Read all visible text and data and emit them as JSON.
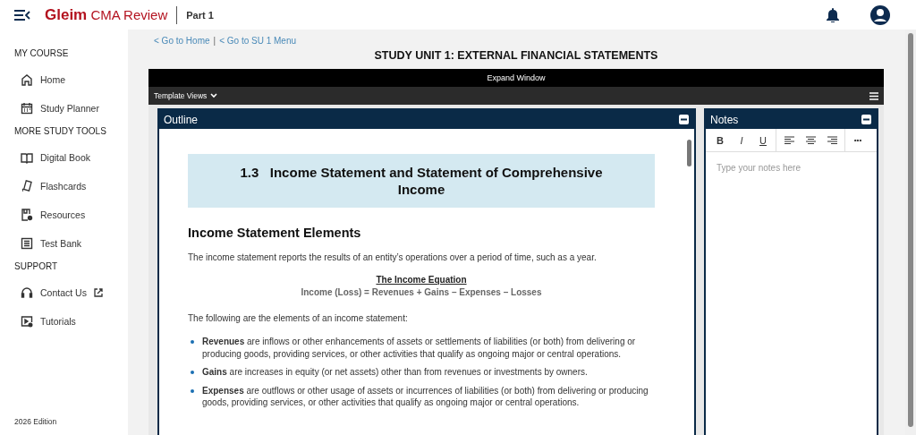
{
  "header": {
    "brand": "Gleim",
    "product": "CMA Review",
    "part": "Part 1"
  },
  "sidebar": {
    "sections": [
      {
        "title": "MY COURSE",
        "items": [
          {
            "label": "Home",
            "external": false
          },
          {
            "label": "Study Planner",
            "external": false
          }
        ]
      },
      {
        "title": "MORE STUDY TOOLS",
        "items": [
          {
            "label": "Digital Book",
            "external": false
          },
          {
            "label": "Flashcards",
            "external": false
          },
          {
            "label": "Resources",
            "external": false
          },
          {
            "label": "Test Bank",
            "external": false
          }
        ]
      },
      {
        "title": "SUPPORT",
        "items": [
          {
            "label": "Contact Us",
            "external": true
          },
          {
            "label": "Tutorials",
            "external": false
          }
        ]
      }
    ],
    "edition": "2026 Edition"
  },
  "breadcrumbs": [
    "< Go to Home",
    "< Go to SU 1 Menu"
  ],
  "breadcrumb_separator": "|",
  "page_title": "STUDY UNIT 1: EXTERNAL FINANCIAL STATEMENTS",
  "expand_window": "Expand Window",
  "template_views": "Template Views",
  "outline": {
    "title": "Outline",
    "section_heading": "1.3   Income Statement and Statement of Comprehensive Income",
    "subheading": "Income Statement Elements",
    "intro": "The income statement reports the results of an entity’s operations over a period of time, such as a year.",
    "equation_title": "The Income Equation",
    "equation": "Income (Loss) = Revenues + Gains – Expenses – Losses",
    "list_intro": "The following are the elements of an income statement:",
    "bullets": [
      "**Revenues** are inflows or other enhancements of assets or settlements of liabilities (or both) from delivering or producing goods, providing services, or other activities that qualify as ongoing major or central operations.",
      "**Gains** are increases in equity (or net assets) other than from revenues or investments by owners.",
      "**Expenses** are outflows or other usage of assets or incurrences of liabilities (or both) from delivering or producing goods, providing services, or other activities that qualify as ongoing major or central operations."
    ]
  },
  "notes": {
    "title": "Notes",
    "format_buttons": [
      "B",
      "I",
      "U"
    ],
    "more_button": "•••",
    "placeholder": "Type your notes here"
  }
}
